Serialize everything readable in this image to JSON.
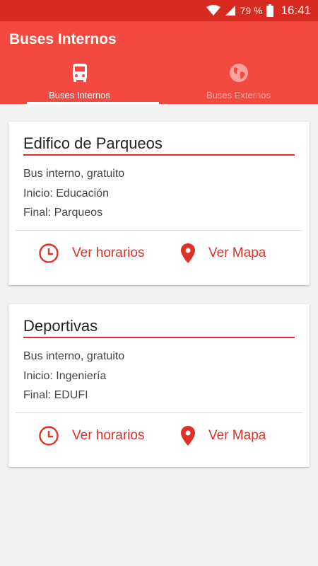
{
  "status_bar": {
    "battery_percent": "79 %",
    "time": "16:41",
    "icons": [
      "wifi-icon",
      "signal-icon",
      "battery-icon"
    ]
  },
  "app_bar": {
    "title": "Buses Internos"
  },
  "tabs": [
    {
      "label": "Buses Internos",
      "icon": "bus-icon",
      "active": true
    },
    {
      "label": "Buses Externos",
      "icon": "globe-icon",
      "active": false
    }
  ],
  "routes": [
    {
      "title": "Edifico de Parqueos",
      "type": "Bus interno, gratuito",
      "start": "Inicio: Educación",
      "end": "Final: Parqueos",
      "schedule_label": "Ver horarios",
      "map_label": "Ver Mapa"
    },
    {
      "title": "Deportivas",
      "type": "Bus interno, gratuito",
      "start": "Inicio: Ingeniería",
      "end": "Final: EDUFI",
      "schedule_label": "Ver horarios",
      "map_label": "Ver Mapa"
    }
  ],
  "colors": {
    "primary": "#f24a41",
    "primary_dark": "#d92a22",
    "accent": "#e0302a",
    "background": "#f3f3f3"
  }
}
